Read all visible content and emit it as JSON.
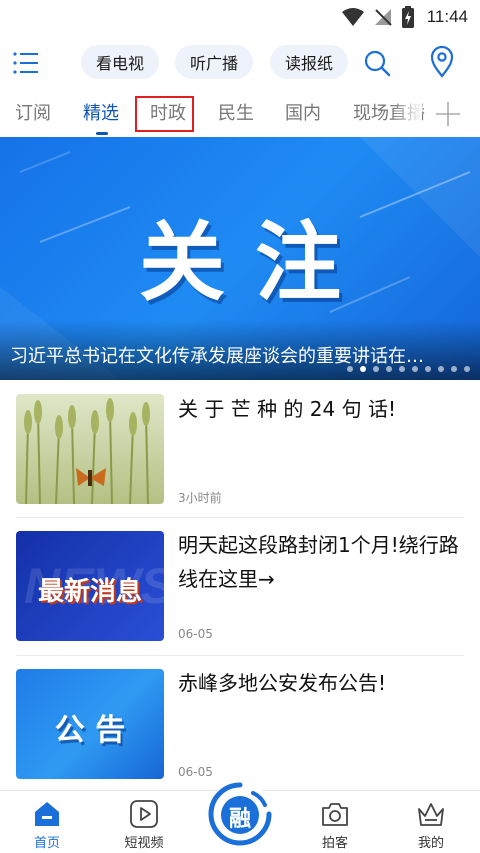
{
  "status_bar": {
    "time": "11:44"
  },
  "toolbar": {
    "tv_label": "看电视",
    "radio_label": "听广播",
    "paper_label": "读报纸"
  },
  "tabs": [
    {
      "label": "订阅"
    },
    {
      "label": "精选"
    },
    {
      "label": "时政"
    },
    {
      "label": "民生"
    },
    {
      "label": "国内"
    },
    {
      "label": "现场直播"
    }
  ],
  "banner": {
    "title": "关注",
    "caption": "习近平总书记在文化传承发展座谈会的重要讲话在…",
    "slide_count": 10,
    "active_slide": 1
  },
  "news": [
    {
      "title": "关 于 芒 种 的 24 句 话!",
      "meta": "3小时前"
    },
    {
      "title": "明天起这段路封闭1个月!绕行路线在这里→",
      "meta": "06-05",
      "thumb_text": "最新消息",
      "thumb_bg_text": "NEWS"
    },
    {
      "title": "赤峰多地公安发布公告!",
      "meta": "06-05",
      "thumb_text": "公 告"
    }
  ],
  "bottom_nav": {
    "home": "首页",
    "short_video": "短视频",
    "center_glyph": "融",
    "snap": "拍客",
    "mine": "我的"
  },
  "colors": {
    "accent": "#0f56b3",
    "highlight_border": "#e02020",
    "banner_blue": "#1a7cf0"
  }
}
